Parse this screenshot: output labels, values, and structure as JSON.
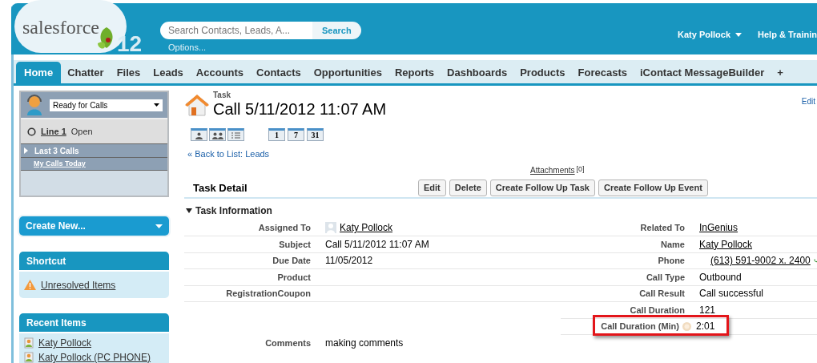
{
  "header": {
    "logo_text": "salesforce",
    "version": "12",
    "search": {
      "placeholder": "Search Contacts, Leads, A...",
      "button": "Search",
      "options_link": "Options..."
    },
    "user_menu": "Katy Pollock",
    "help_link": "Help & Trainin"
  },
  "tabs": [
    {
      "label": "Home",
      "selected": true
    },
    {
      "label": "Chatter",
      "selected": false
    },
    {
      "label": "Files",
      "selected": false
    },
    {
      "label": "Leads",
      "selected": false
    },
    {
      "label": "Accounts",
      "selected": false
    },
    {
      "label": "Contacts",
      "selected": false
    },
    {
      "label": "Opportunities",
      "selected": false
    },
    {
      "label": "Reports",
      "selected": false
    },
    {
      "label": "Dashboards",
      "selected": false
    },
    {
      "label": "Products",
      "selected": false
    },
    {
      "label": "Forecasts",
      "selected": false
    },
    {
      "label": "iContact MessageBuilder",
      "selected": false
    },
    {
      "label": "+",
      "selected": false
    }
  ],
  "sidebar": {
    "phone_widget": {
      "status": "Ready for Calls",
      "line": "Line 1",
      "line_state": "Open",
      "last_calls": "Last 3 Calls",
      "my_calls_link": "My Calls Today"
    },
    "create_new": "Create New...",
    "shortcut": {
      "title": "Shortcut",
      "items": [
        "Unresolved Items"
      ]
    },
    "recent_items": {
      "title": "Recent Items",
      "items": [
        "Katy Pollock",
        "Katy Pollock (PC PHONE)"
      ]
    }
  },
  "record": {
    "type": "Task",
    "title": "Call 5/11/2012 11:07 AM",
    "edit_link": "Edit",
    "view_buttons": [
      "1",
      "7",
      "31"
    ],
    "back_link": "« Back to List: Leads",
    "attachments": "Attachments",
    "attachments_count": "[0]"
  },
  "detail": {
    "title": "Task Detail",
    "buttons": [
      "Edit",
      "Delete",
      "Create Follow Up Task",
      "Create Follow Up Event"
    ],
    "section": "Task Information",
    "left": [
      {
        "label": "Assigned To",
        "value": "Katy Pollock",
        "kind": "user"
      },
      {
        "label": "Subject",
        "value": "Call 5/11/2012 11:07 AM",
        "kind": "text"
      },
      {
        "label": "Due Date",
        "value": "11/05/2012",
        "kind": "text"
      },
      {
        "label": "Product"
      },
      {
        "label": "RegistrationCoupon"
      }
    ],
    "right": [
      {
        "label": "Related To",
        "value": "InGenius",
        "kind": "link",
        "highlighted": false
      },
      {
        "label": "Name",
        "value": "Katy Pollock",
        "kind": "link",
        "highlighted": false
      },
      {
        "label": "Phone",
        "value": "(613) 591-9002 x. 2400",
        "kind": "phone",
        "highlighted": false
      },
      {
        "label": "Call Type",
        "value": "Outbound",
        "kind": "text",
        "highlighted": false
      },
      {
        "label": "Call Result",
        "value": "Call successful",
        "kind": "text",
        "highlighted": false
      },
      {
        "label": "Call Duration",
        "value": "121",
        "kind": "text",
        "highlighted": false
      },
      {
        "label": "Call Duration (Min)",
        "value": "2:01",
        "kind": "help",
        "highlighted": true
      }
    ],
    "comments": {
      "label": "Comments",
      "value": "making comments"
    }
  }
}
